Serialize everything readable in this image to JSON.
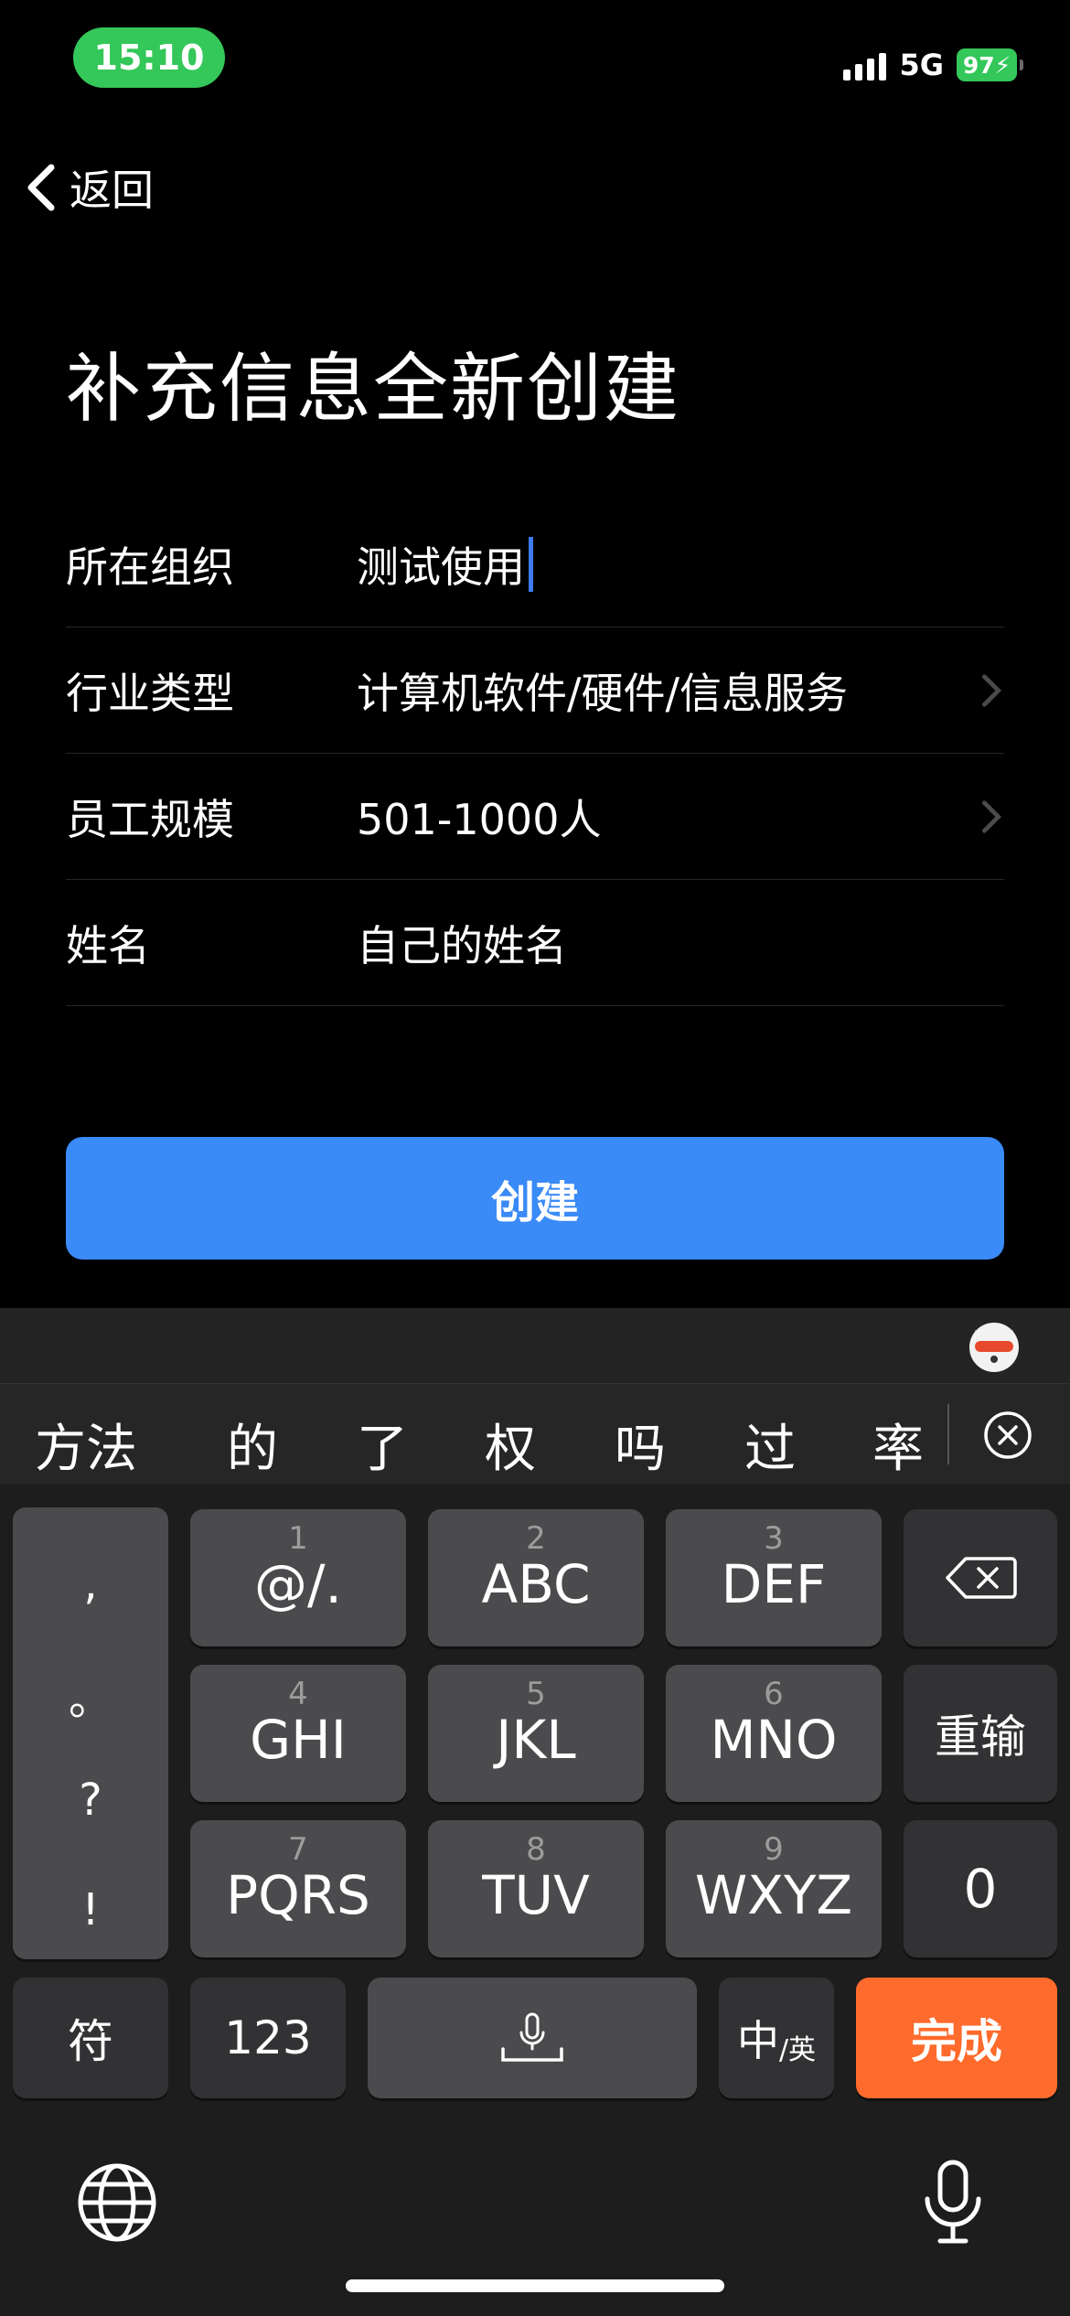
{
  "status": {
    "time": "15:10",
    "network": "5G",
    "battery": "97"
  },
  "nav": {
    "back_label": "返回"
  },
  "page": {
    "title": "补充信息全新创建"
  },
  "form": {
    "org_label": "所在组织",
    "org_value": "测试使用",
    "industry_label": "行业类型",
    "industry_value": "计算机软件/硬件/信息服务",
    "staff_label": "员工规模",
    "staff_value": "501-1000人",
    "name_label": "姓名",
    "name_value": "自己的姓名"
  },
  "create_button": "创建",
  "keyboard": {
    "candidates": [
      "方法",
      "的",
      "了",
      "权",
      "吗",
      "过",
      "率"
    ],
    "side_punct": [
      ",",
      "。",
      "?",
      "!"
    ],
    "keys": [
      {
        "num": "1",
        "letters": "@/."
      },
      {
        "num": "2",
        "letters": "ABC"
      },
      {
        "num": "3",
        "letters": "DEF"
      },
      {
        "num": "4",
        "letters": "GHI"
      },
      {
        "num": "5",
        "letters": "JKL"
      },
      {
        "num": "6",
        "letters": "MNO"
      },
      {
        "num": "7",
        "letters": "PQRS"
      },
      {
        "num": "8",
        "letters": "TUV"
      },
      {
        "num": "9",
        "letters": "WXYZ"
      }
    ],
    "reenter_label": "重输",
    "zero_label": "0",
    "symbols_label": "符",
    "numeric_label": "123",
    "lang_main": "中",
    "lang_sub": "/英",
    "done_label": "完成",
    "accent_color": "#ff6b2c"
  },
  "icons": {
    "back": "chevron-left-icon",
    "chevron": "chevron-right-icon",
    "backspace": "backspace-icon",
    "mic": "microphone-icon",
    "globe": "globe-icon",
    "clear": "clear-candidates-icon"
  }
}
